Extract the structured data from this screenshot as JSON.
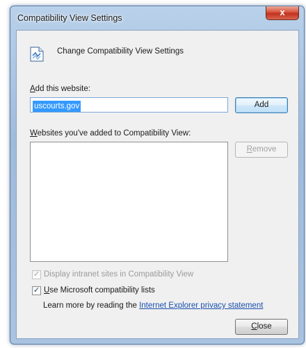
{
  "window": {
    "title": "Compatibility View Settings",
    "close_glyph": "x"
  },
  "header": {
    "icon": "compatibility-page-icon",
    "text": "Change Compatibility View Settings"
  },
  "add_section": {
    "label_accesskey": "A",
    "label_rest": "dd this website:",
    "input_value": "uscourts.gov",
    "add_button": "Add"
  },
  "list_section": {
    "label_accesskey": "W",
    "label_rest": "ebsites you've added to Compatibility View:",
    "items": [],
    "remove_accesskey": "R",
    "remove_rest": "emove"
  },
  "options": {
    "intranet": {
      "label": "Display intranet sites in Compatibility View",
      "checked": true,
      "disabled": true
    },
    "ms_lists": {
      "label_accesskey": "U",
      "label_rest": "se Microsoft compatibility lists",
      "checked": true,
      "disabled": false
    }
  },
  "learn_more": {
    "prefix": "Learn more by reading the",
    "link": "Internet Explorer privacy statement"
  },
  "close_button": {
    "accesskey": "C",
    "rest": "lose"
  },
  "colors": {
    "selection": "#3399ff",
    "link": "#1a4fb0",
    "close_button_red": "#d9533d"
  }
}
